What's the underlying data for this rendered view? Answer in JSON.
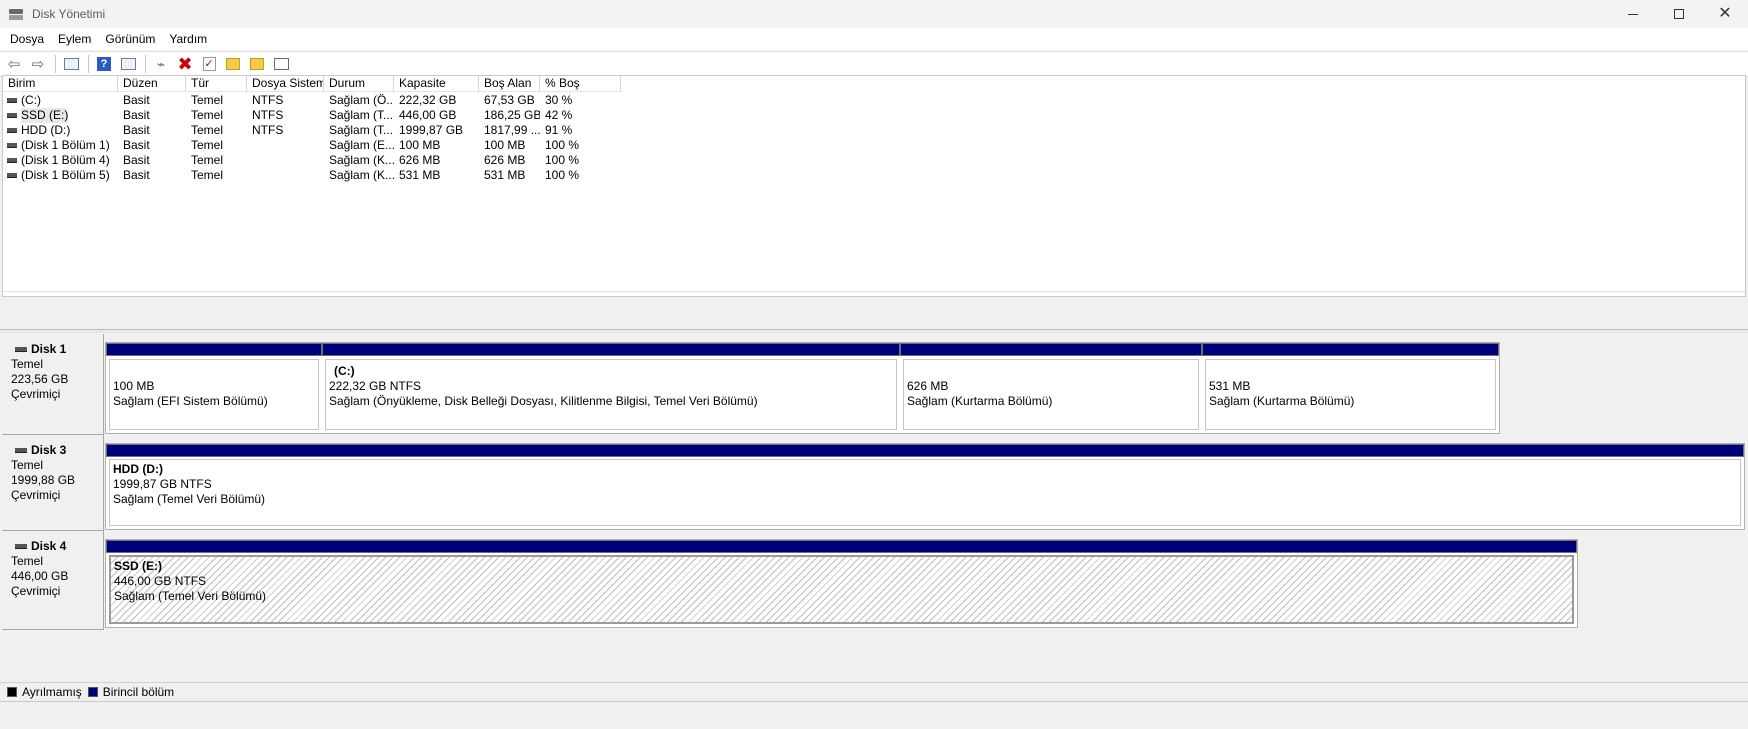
{
  "window": {
    "title": "Disk Yönetimi",
    "controls": {
      "minimize": "—",
      "maximize": "☐",
      "close": "✕"
    }
  },
  "menu": [
    "Dosya",
    "Eylem",
    "Görünüm",
    "Yardım"
  ],
  "toolbar": {
    "icons": [
      "back-arrow-icon",
      "forward-arrow-icon",
      "console-tree-icon",
      "help-icon",
      "view-icon",
      "connect-icon",
      "delete-icon",
      "check-icon",
      "folder-up-icon",
      "folder-search-icon",
      "properties-icon"
    ]
  },
  "volume_list": {
    "columns": [
      "Birim",
      "Düzen",
      "Tür",
      "Dosya Sistemi",
      "Durum",
      "Kapasite",
      "Boş Alan",
      "% Boş"
    ],
    "rows": [
      [
        "(C:)",
        "Basit",
        "Temel",
        "NTFS",
        "Sağlam (Ö...",
        "222,32 GB",
        "67,53 GB",
        "30 %"
      ],
      [
        "SSD (E:)",
        "Basit",
        "Temel",
        "NTFS",
        "Sağlam (T...",
        "446,00 GB",
        "186,25 GB",
        "42 %"
      ],
      [
        "HDD (D:)",
        "Basit",
        "Temel",
        "NTFS",
        "Sağlam (T...",
        "1999,87 GB",
        "1817,99 ...",
        "91 %"
      ],
      [
        "(Disk 1 Bölüm 1)",
        "Basit",
        "Temel",
        "",
        "Sağlam (E...",
        "100 MB",
        "100 MB",
        "100 %"
      ],
      [
        "(Disk 1 Bölüm 4)",
        "Basit",
        "Temel",
        "",
        "Sağlam (K...",
        "626 MB",
        "626 MB",
        "100 %"
      ],
      [
        "(Disk 1 Bölüm 5)",
        "Basit",
        "Temel",
        "",
        "Sağlam (K...",
        "531 MB",
        "531 MB",
        "100 %"
      ]
    ]
  },
  "disks": [
    {
      "name": "Disk 1",
      "type": "Temel",
      "size": "223,56 GB",
      "status": "Çevrimiçi",
      "partitions": [
        {
          "title": "",
          "size": "100 MB",
          "status": "Sağlam (EFI Sistem Bölümü)"
        },
        {
          "title": "(C:)",
          "size": "222,32 GB NTFS",
          "status": "Sağlam (Önyükleme, Disk Belleği Dosyası, Kilitlenme Bilgisi, Temel Veri Bölümü)"
        },
        {
          "title": "",
          "size": "626 MB",
          "status": "Sağlam (Kurtarma Bölümü)"
        },
        {
          "title": "",
          "size": "531 MB",
          "status": "Sağlam (Kurtarma Bölümü)"
        }
      ]
    },
    {
      "name": "Disk 3",
      "type": "Temel",
      "size": "1999,88 GB",
      "status": "Çevrimiçi",
      "partitions": [
        {
          "title": "HDD  (D:)",
          "size": "1999,87 GB NTFS",
          "status": "Sağlam (Temel Veri Bölümü)"
        }
      ]
    },
    {
      "name": "Disk 4",
      "type": "Temel",
      "size": "446,00 GB",
      "status": "Çevrimiçi",
      "partitions": [
        {
          "title": "SSD  (E:)",
          "size": "446,00 GB NTFS",
          "status": "Sağlam (Temel Veri Bölümü)"
        }
      ]
    }
  ],
  "legend": [
    {
      "label": "Ayrılmamış",
      "color": "#000000"
    },
    {
      "label": "Birincil bölüm",
      "color": "#00007d"
    }
  ]
}
